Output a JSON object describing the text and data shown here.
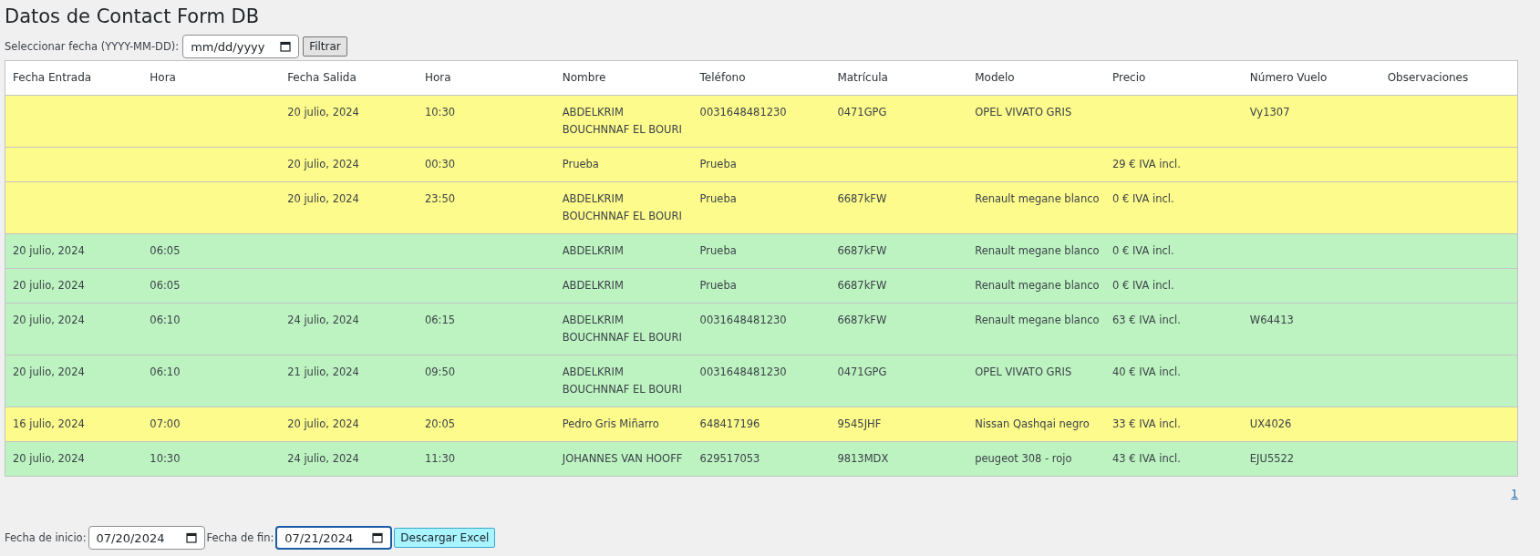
{
  "title": "Datos de Contact Form DB",
  "filter": {
    "label": "Seleccionar fecha (YYYY-MM-DD):",
    "placeholder": "mm/dd/yyyy",
    "button": "Filtrar"
  },
  "table": {
    "columns": [
      "Fecha Entrada",
      "Hora",
      "Fecha Salida",
      "Hora",
      "Nombre",
      "Teléfono",
      "Matrícula",
      "Modelo",
      "Precio",
      "Número Vuelo",
      "Observaciones"
    ],
    "rows": [
      {
        "color": "#fdfb8b",
        "fecha_salida": "20 julio, 2024",
        "hora_salida": "10:30",
        "nombre": "ABDELKRIM BOUCHNNAF EL BOURI",
        "telefono": "0031648481230",
        "matricula": "0471GPG",
        "modelo": "OPEL VIVATO GRIS",
        "vuelo": "Vy1307"
      },
      {
        "color": "#fdfb8b",
        "fecha_salida": "20 julio, 2024",
        "hora_salida": "00:30",
        "nombre": "Prueba",
        "telefono": "Prueba",
        "precio": "29 € IVA incl."
      },
      {
        "color": "#fdfb8b",
        "fecha_salida": "20 julio, 2024",
        "hora_salida": "23:50",
        "nombre": "ABDELKRIM BOUCHNNAF EL BOURI",
        "telefono": "Prueba",
        "matricula": "6687kFW",
        "modelo": "Renault megane blanco",
        "precio": "0 € IVA incl."
      },
      {
        "color": "#bdf3c0",
        "fecha_entrada": "20 julio, 2024",
        "hora_entrada": "06:05",
        "nombre": "ABDELKRIM",
        "telefono": "Prueba",
        "matricula": "6687kFW",
        "modelo": "Renault megane blanco",
        "precio": "0 € IVA incl."
      },
      {
        "color": "#bdf3c0",
        "fecha_entrada": "20 julio, 2024",
        "hora_entrada": "06:05",
        "nombre": "ABDELKRIM",
        "telefono": "Prueba",
        "matricula": "6687kFW",
        "modelo": "Renault megane blanco",
        "precio": "0 € IVA incl."
      },
      {
        "color": "#bdf3c0",
        "fecha_entrada": "20 julio, 2024",
        "hora_entrada": "06:10",
        "fecha_salida": "24 julio, 2024",
        "hora_salida": "06:15",
        "nombre": "ABDELKRIM BOUCHNNAF EL BOURI",
        "telefono": "0031648481230",
        "matricula": "6687kFW",
        "modelo": "Renault megane blanco",
        "precio": "63 € IVA incl.",
        "vuelo": "W64413"
      },
      {
        "color": "#bdf3c0",
        "fecha_entrada": "20 julio, 2024",
        "hora_entrada": "06:10",
        "fecha_salida": "21 julio, 2024",
        "hora_salida": "09:50",
        "nombre": "ABDELKRIM BOUCHNNAF EL BOURI",
        "telefono": "0031648481230",
        "matricula": "0471GPG",
        "modelo": "OPEL VIVATO GRIS",
        "precio": "40 € IVA incl."
      },
      {
        "color": "#fdfb8b",
        "fecha_entrada": "16 julio, 2024",
        "hora_entrada": "07:00",
        "fecha_salida": "20 julio, 2024",
        "hora_salida": "20:05",
        "nombre": "Pedro Gris Miñarro",
        "telefono": "648417196",
        "matricula": "9545JHF",
        "modelo": "Nissan Qashqai negro",
        "precio": "33 € IVA incl.",
        "vuelo": "UX4026"
      },
      {
        "color": "#bdf3c0",
        "fecha_entrada": "20 julio, 2024",
        "hora_entrada": "10:30",
        "fecha_salida": "24 julio, 2024",
        "hora_salida": "11:30",
        "nombre": "JOHANNES VAN HOOFF",
        "telefono": "629517053",
        "matricula": "9813MDX",
        "modelo": "peugeot 308 - rojo",
        "precio": "43 € IVA incl.",
        "vuelo": "EJU5522"
      }
    ]
  },
  "pagination": [
    "1"
  ],
  "export": {
    "start_label": "Fecha de inicio:",
    "start_value": "07/20/2024",
    "end_label": "Fecha de fin:",
    "end_value": "07/21/2024",
    "end_focused": true,
    "button": "Descargar Excel"
  }
}
